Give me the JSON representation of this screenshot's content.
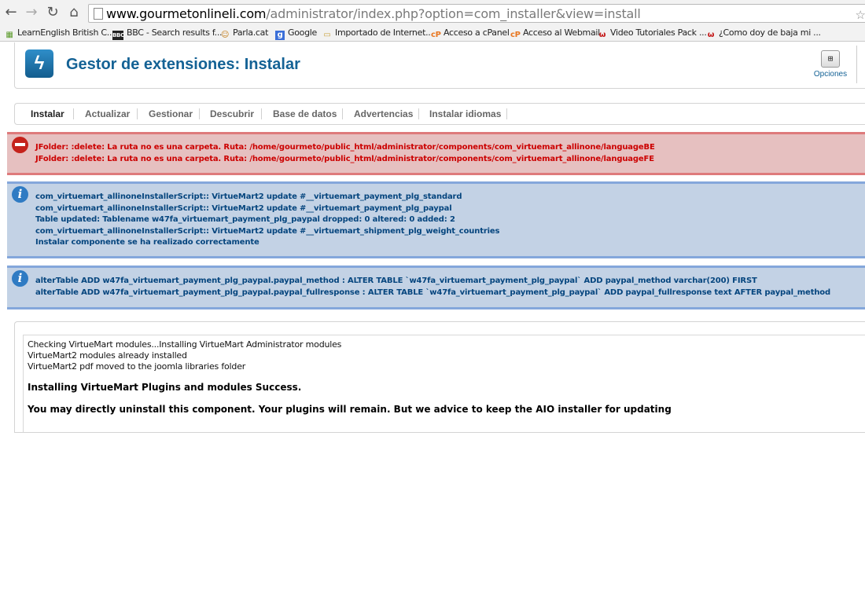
{
  "browser": {
    "url_host": "www.gourmetonlineli.com",
    "url_path": "/administrator/index.php?option=com_installer&view=install",
    "bookmarks": [
      {
        "label": "LearnEnglish British C...",
        "icon": "grid-icon"
      },
      {
        "label": "BBC - Search results f...",
        "icon": "bbc-icon"
      },
      {
        "label": "Parla.cat",
        "icon": "parla-icon"
      },
      {
        "label": "Google",
        "icon": "google-icon"
      },
      {
        "label": "Importado de Internet...",
        "icon": "folder-icon"
      },
      {
        "label": "Acceso a cPanel",
        "icon": "cpanel-icon"
      },
      {
        "label": "Acceso al Webmail",
        "icon": "cpanel-icon"
      },
      {
        "label": "Video Tutoriales Pack ...",
        "icon": "w-icon"
      },
      {
        "label": "¿Como doy de baja mi ...",
        "icon": "w-icon"
      }
    ]
  },
  "header": {
    "title": "Gestor de extensiones: Instalar",
    "options_label": "Opciones"
  },
  "tabs": [
    "Instalar",
    "Actualizar",
    "Gestionar",
    "Descubrir",
    "Base de datos",
    "Advertencias",
    "Instalar idiomas"
  ],
  "messages": {
    "error": [
      "JFolder: :delete: La ruta no es una carpeta. Ruta: /home/gourmeto/public_html/administrator/components/com_virtuemart_allinone/languageBE",
      "JFolder: :delete: La ruta no es una carpeta. Ruta: /home/gourmeto/public_html/administrator/components/com_virtuemart_allinone/languageFE"
    ],
    "info1": [
      "com_virtuemart_allinoneInstallerScript:: VirtueMart2 update #__virtuemart_payment_plg_standard",
      "com_virtuemart_allinoneInstallerScript:: VirtueMart2 update #__virtuemart_payment_plg_paypal",
      "Table updated: Tablename w47fa_virtuemart_payment_plg_paypal dropped: 0 altered: 0 added: 2",
      "com_virtuemart_allinoneInstallerScript:: VirtueMart2 update #__virtuemart_shipment_plg_weight_countries",
      "Instalar componente se ha realizado correctamente"
    ],
    "info2": [
      "alterTable ADD w47fa_virtuemart_payment_plg_paypal.paypal_method : ALTER TABLE `w47fa_virtuemart_payment_plg_paypal` ADD paypal_method varchar(200) FIRST",
      "alterTable ADD w47fa_virtuemart_payment_plg_paypal.paypal_fullresponse : ALTER TABLE `w47fa_virtuemart_payment_plg_paypal` ADD paypal_fullresponse text AFTER paypal_method"
    ]
  },
  "content": {
    "lines": [
      "Checking VirtueMart modules...Installing VirtueMart Administrator modules",
      "VirtueMart2 modules already installed",
      "VirtueMart2 pdf moved to the joomla libraries folder"
    ],
    "success": "Installing VirtueMart Plugins and modules Success.",
    "advice": "You may directly uninstall this component. Your plugins will remain. But we advice to keep the AIO installer for updating"
  }
}
